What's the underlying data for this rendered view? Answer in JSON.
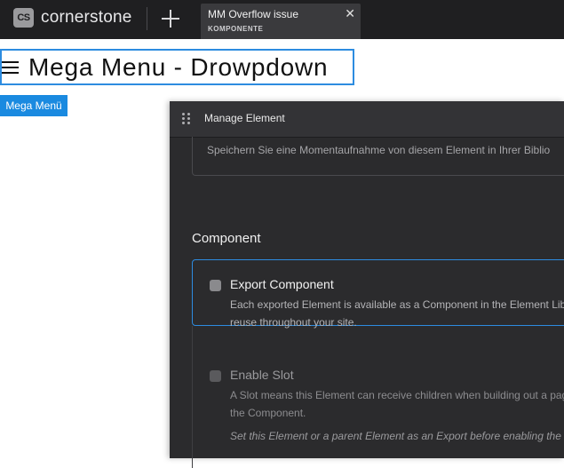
{
  "topbar": {
    "logo_text": "CS",
    "brand": "cornerstone",
    "add_label": "+",
    "tab": {
      "title": "MM Overflow issue",
      "subtitle": "KOMPONENTE",
      "close": "✕"
    }
  },
  "page": {
    "title": "Mega Menu - Drowpdown",
    "menu_button": "Mega Menü"
  },
  "panel": {
    "title": "Manage Element",
    "snapshot_text": "Speichern Sie eine Momentaufnahme von diesem Element in Ihrer Biblio",
    "section_title": "Component",
    "export": {
      "title": "Export Component",
      "desc_line1": "Each exported Element is available as a Component in the Element Libr",
      "desc_line2": "reuse throughout your site."
    },
    "slot": {
      "title": "Enable Slot",
      "desc_line1": "A Slot means this Element can receive children when building out a pag",
      "desc_line2": "the Component.",
      "note": "Set this Element or a parent Element as an Export before enabling the S"
    }
  },
  "colors": {
    "accent": "#2d8ce0",
    "button": "#1a8ae0",
    "panel_bg": "#2b2b2d",
    "topbar_bg": "#1f1f21"
  }
}
